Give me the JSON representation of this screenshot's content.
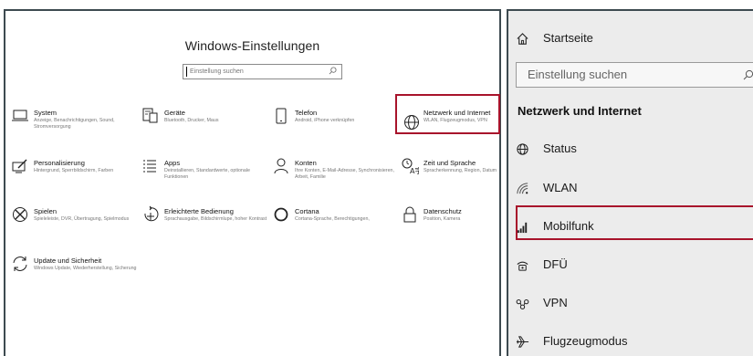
{
  "window": {
    "title": "Windows-Einstellungen"
  },
  "search": {
    "placeholder": "Einstellung suchen"
  },
  "categories": [
    {
      "key": "system",
      "title": "System",
      "subtitle": "Anzeige, Benachrichtigungen, Sound, Stromversorgung",
      "icon": "laptop-icon"
    },
    {
      "key": "geraete",
      "title": "Geräte",
      "subtitle": "Bluetooth, Drucker, Maus",
      "icon": "devices-icon"
    },
    {
      "key": "telefon",
      "title": "Telefon",
      "subtitle": "Android, iPhone verknüpfen",
      "icon": "phone-icon"
    },
    {
      "key": "netzwerk",
      "title": "Netzwerk und Internet",
      "subtitle": "WLAN, Flugzeugmodus, VPN",
      "icon": "globe-icon"
    },
    {
      "key": "personalisierung",
      "title": "Personalisierung",
      "subtitle": "Hintergrund, Sperrbildschirm, Farben",
      "icon": "paint-icon"
    },
    {
      "key": "apps",
      "title": "Apps",
      "subtitle": "Deinstallieren, Standardwerte, optionale Funktionen",
      "icon": "apps-list-icon"
    },
    {
      "key": "konten",
      "title": "Konten",
      "subtitle": "Ihre Konten, E-Mail-Adresse, Synchronisieren, Arbeit, Familie",
      "icon": "person-icon"
    },
    {
      "key": "zeit",
      "title": "Zeit und Sprache",
      "subtitle": "Spracherkennung, Region, Datum",
      "icon": "time-language-icon"
    },
    {
      "key": "spielen",
      "title": "Spielen",
      "subtitle": "Spieleleiste, DVR, Übertragung, Spielmodus",
      "icon": "xbox-icon"
    },
    {
      "key": "erleichterte",
      "title": "Erleichterte Bedienung",
      "subtitle": "Sprachausgabe, Bildschirmlupe, hoher Kontrast",
      "icon": "ease-of-access-icon"
    },
    {
      "key": "cortana",
      "title": "Cortana",
      "subtitle": "Cortana-Sprache, Berechtigungen,",
      "icon": "cortana-icon"
    },
    {
      "key": "datenschutz",
      "title": "Datenschutz",
      "subtitle": "Position, Kamera",
      "icon": "lock-icon"
    },
    {
      "key": "update",
      "title": "Update und Sicherheit",
      "subtitle": "Windows Update, Wiederherstellung, Sicherung",
      "icon": "sync-icon"
    }
  ],
  "sidebar": {
    "home_label": "Startseite",
    "search_placeholder": "Einstellung suchen",
    "section_title": "Netzwerk und Internet",
    "items": [
      {
        "label": "Status",
        "icon": "globe-icon"
      },
      {
        "label": "WLAN",
        "icon": "wifi-icon"
      },
      {
        "label": "Mobilfunk",
        "icon": "cellular-icon"
      },
      {
        "label": "DFÜ",
        "icon": "dialup-icon"
      },
      {
        "label": "VPN",
        "icon": "vpn-icon"
      },
      {
        "label": "Flugzeugmodus",
        "icon": "airplane-icon"
      }
    ]
  },
  "colors": {
    "highlight": "#a8132b",
    "panel_border": "#3d4a50",
    "sidebar_bg": "#ececec"
  }
}
